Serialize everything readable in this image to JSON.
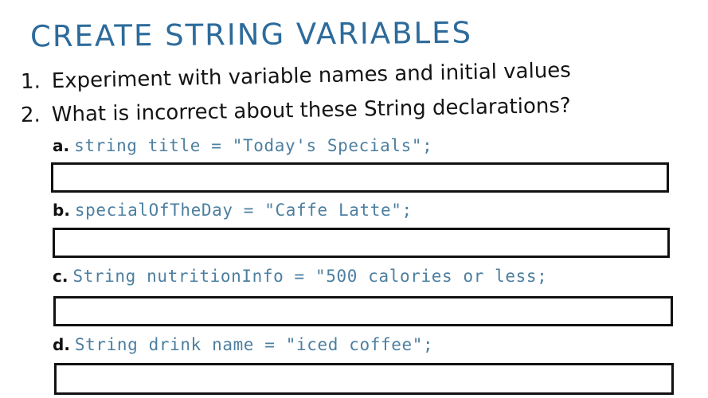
{
  "title": "CREATE STRING VARIABLES",
  "instructions": [
    {
      "number": "1.",
      "text": "Experiment with variable names and initial values"
    },
    {
      "number": "2.",
      "text": "What is incorrect about these String declarations?"
    }
  ],
  "questions": [
    {
      "letter": "a.",
      "code": "string title = \"Today's Specials\";"
    },
    {
      "letter": "b.",
      "code": "specialOfTheDay = \"Caffe Latte\";"
    },
    {
      "letter": "c.",
      "code": "String nutritionInfo = \"500 calories or less;"
    },
    {
      "letter": "d.",
      "code": "String drink name = \"iced coffee\";"
    }
  ],
  "colors": {
    "title": "#2d6b9b",
    "code": "#4d7fa0",
    "handwriting": "#141414"
  }
}
